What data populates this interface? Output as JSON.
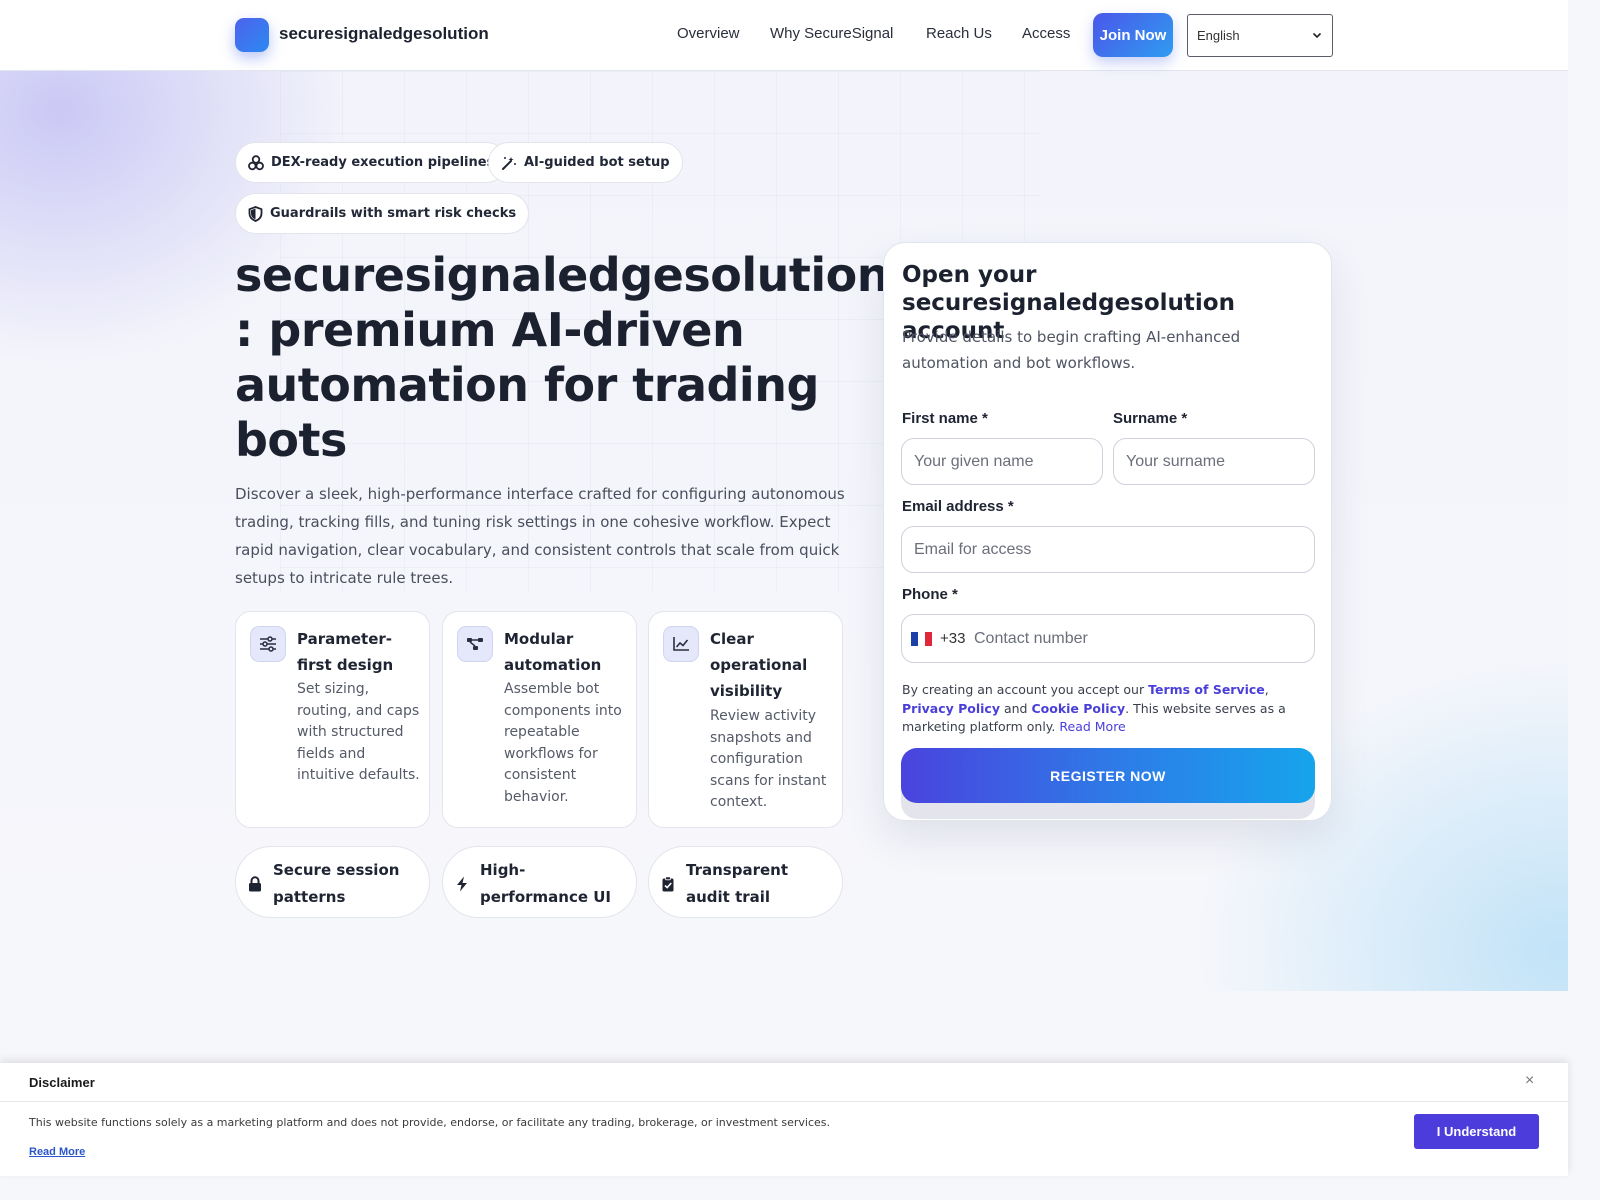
{
  "header": {
    "brand": "securesignaledgesolution",
    "nav": [
      "Overview",
      "Why SecureSignal",
      "Reach Us",
      "Access"
    ],
    "join_label": "Join Now",
    "language": "English"
  },
  "pills": [
    {
      "icon": "cubes-icon",
      "label": "DEX-ready execution pipelines"
    },
    {
      "icon": "magic-wand-icon",
      "label": "AI-guided bot setup"
    },
    {
      "icon": "shield-icon",
      "label": "Guardrails with smart risk checks"
    }
  ],
  "hero": {
    "title": "securesignaledgesolution : premium AI-driven automation for trading bots",
    "description": "Discover a sleek, high-performance interface crafted for configuring autonomous trading, tracking fills, and tuning risk settings in one cohesive workflow. Expect rapid navigation, clear vocabulary, and consistent controls that scale from quick setups to intricate rule trees."
  },
  "features": [
    {
      "icon": "sliders-icon",
      "title": "Parameter-first design",
      "desc": "Set sizing, routing, and caps with structured fields and intuitive defaults."
    },
    {
      "icon": "nodes-icon",
      "title": "Modular automation",
      "desc": "Assemble bot components into repeatable workflows for consistent behavior."
    },
    {
      "icon": "chart-line-icon",
      "title": "Clear operational visibility",
      "desc": "Review activity snapshots and configuration scans for instant context."
    }
  ],
  "badges": [
    {
      "icon": "lock-icon",
      "label": "Secure session patterns"
    },
    {
      "icon": "bolt-icon",
      "label": "High-performance UI"
    },
    {
      "icon": "clipboard-check-icon",
      "label": "Transparent audit trail"
    }
  ],
  "form": {
    "title": "Open your securesignaledgesolution account",
    "subtitle": "Provide details to begin crafting AI-enhanced automation and bot workflows.",
    "first_name_label": "First name *",
    "first_name_placeholder": "Your given name",
    "surname_label": "Surname *",
    "surname_placeholder": "Your surname",
    "email_label": "Email address *",
    "email_placeholder": "Email for access",
    "phone_label": "Phone *",
    "phone_code": "+33",
    "phone_placeholder": "Contact number",
    "terms_prefix": "By creating an account you accept our",
    "terms_link": "Terms of Service",
    "terms_sep": ",",
    "privacy_link": "Privacy Policy",
    "terms_and": "and",
    "cookie_link": "Cookie Policy",
    "terms_suffix": ". This website serves as a marketing platform only.",
    "read_more": "Read More",
    "register_label": "REGISTER NOW"
  },
  "disclaimer": {
    "title": "Disclaimer",
    "close": "×",
    "text": "This website functions solely as a marketing platform and does not provide, endorse, or facilitate any trading, brokerage, or investment services.",
    "read_more": "Read More",
    "button": "I Understand"
  },
  "colors": {
    "accent": "#4c3cdc",
    "brand_gradient_start": "#4f62ee",
    "brand_gradient_end": "#2a8af0"
  }
}
